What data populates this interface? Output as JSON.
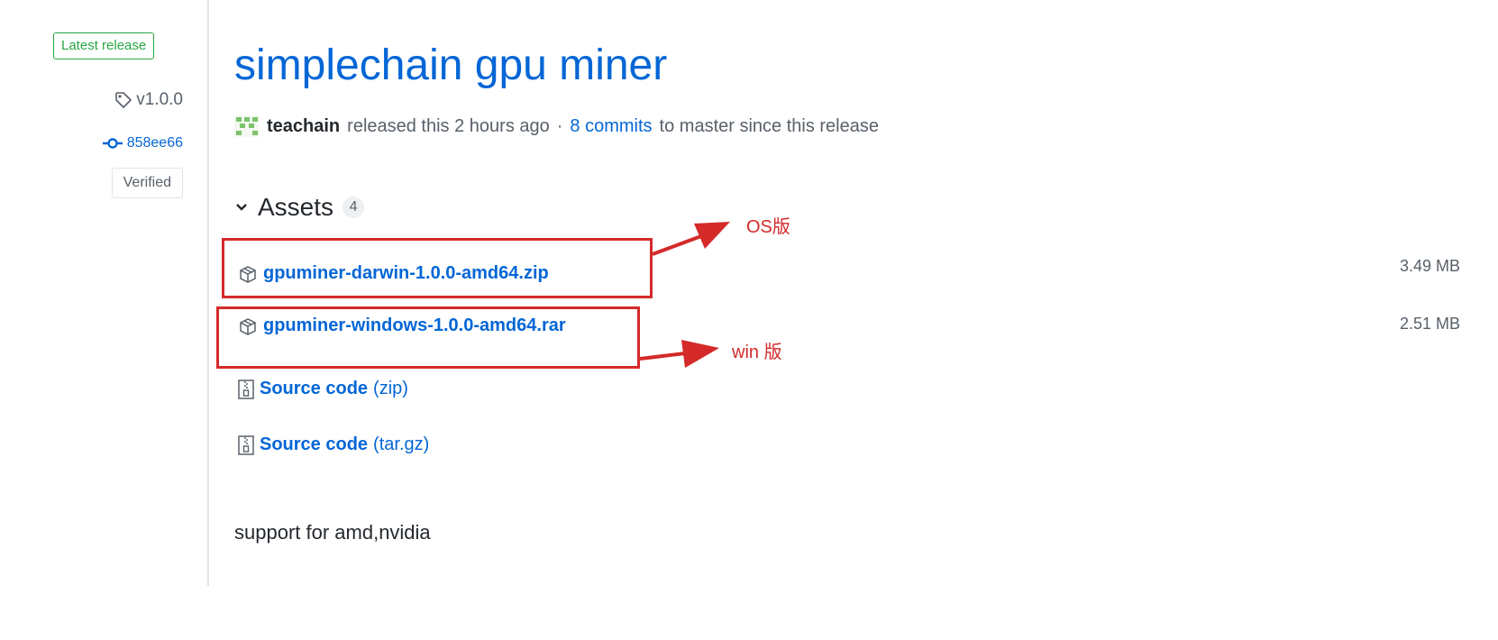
{
  "sidebar": {
    "latest_badge": "Latest release",
    "tag": "v1.0.0",
    "commit": "858ee66",
    "verified": "Verified"
  },
  "release": {
    "title": "simplechain gpu miner",
    "author": "teachain",
    "released_text": "released this 2 hours ago",
    "separator": "·",
    "commits_link": "8 commits",
    "commits_suffix": "to master since this release"
  },
  "assets": {
    "heading": "Assets",
    "count": "4",
    "items": [
      {
        "name": "gpuminer-darwin-1.0.0-amd64.zip",
        "size": "3.49 MB"
      },
      {
        "name": "gpuminer-windows-1.0.0-amd64.rar",
        "size": "2.51 MB"
      },
      {
        "name": "Source code",
        "suffix": "(zip)"
      },
      {
        "name": "Source code",
        "suffix": "(tar.gz)"
      }
    ]
  },
  "notes": "support for amd,nvidia",
  "annotations": {
    "os_label": "OS版",
    "win_label": "win 版",
    "color": "#d42a2a"
  }
}
